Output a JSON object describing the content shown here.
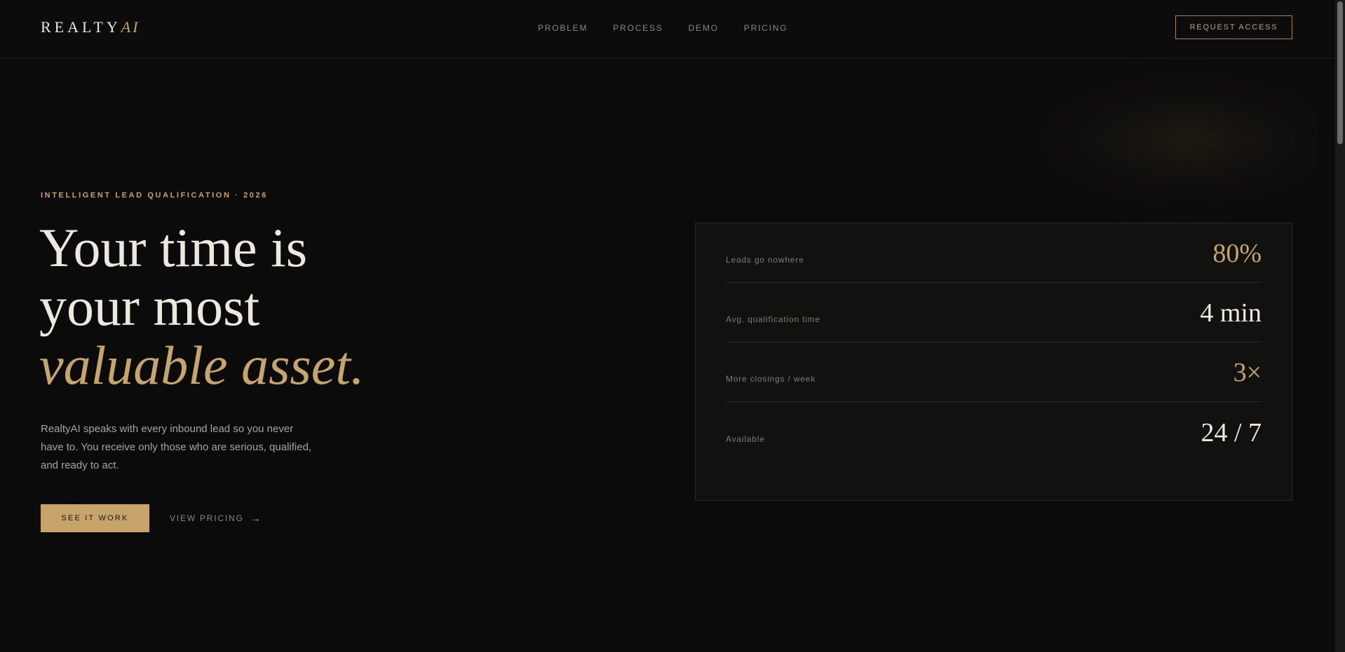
{
  "nav": {
    "logo_main": "REALTY",
    "logo_accent": "AI",
    "links": [
      "PROBLEM",
      "PROCESS",
      "DEMO",
      "PRICING"
    ],
    "cta_label": "REQUEST ACCESS"
  },
  "hero": {
    "eyebrow": "INTELLIGENT LEAD QUALIFICATION · 2026",
    "headline_line1": "Your time is",
    "headline_line2": "your most",
    "headline_line3": "valuable asset.",
    "lede": "RealtyAI speaks with every inbound lead so you never have to. You receive only those who are serious, qualified, and ready to act.",
    "primary_cta": "SEE IT WORK",
    "secondary_cta": "VIEW PRICING",
    "secondary_icon": "arrow-right-icon"
  },
  "stats": [
    {
      "label": "Leads go nowhere",
      "value": "80%",
      "highlight": true
    },
    {
      "label": "Avg. qualification time",
      "value": "4 min",
      "highlight": false
    },
    {
      "label": "More closings / week",
      "value": "3×",
      "highlight": true
    },
    {
      "label": "Available",
      "value": "24 / 7",
      "highlight": false
    }
  ],
  "colors": {
    "background": "#0b0b0b",
    "accent": "#c6a46a",
    "text": "#ece7df",
    "muted": "#8c8780"
  }
}
